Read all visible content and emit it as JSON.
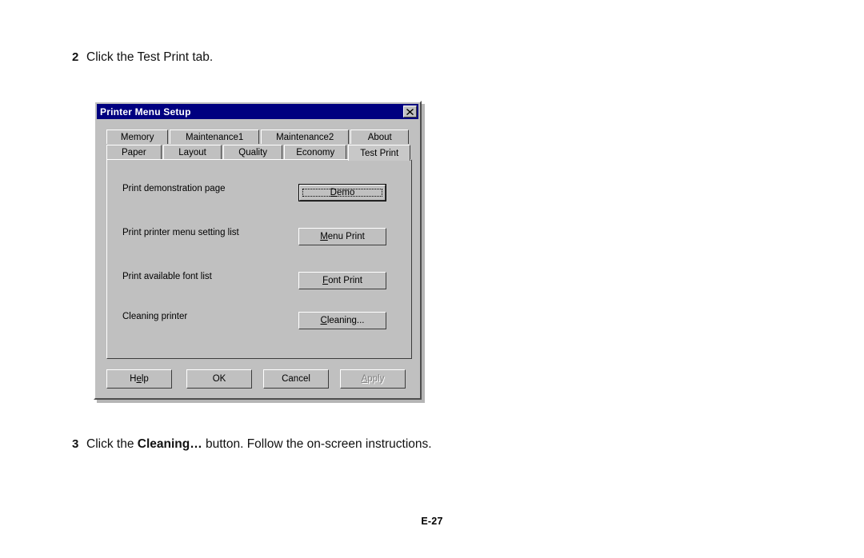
{
  "page": {
    "steps": [
      {
        "number": "2",
        "text": "Click the Test Print tab."
      },
      {
        "number": "3",
        "text_before": "Click the ",
        "emphasis": "Cleaning…",
        "text_after": " button.  Follow the on-screen instructions."
      }
    ],
    "footer": "E-27"
  },
  "dialog": {
    "title": "Printer Menu Setup",
    "close_button": "close-icon",
    "colors": {
      "titlebar": "#000080",
      "titlebar_text": "#ffffff",
      "face": "#c0c0c0",
      "shadow": "#3c3c3c",
      "highlight": "#ffffff",
      "disabled_text": "#808080"
    },
    "tabs": {
      "row_top": [
        {
          "label": "Memory",
          "selected": false
        },
        {
          "label": "Maintenance1",
          "selected": false
        },
        {
          "label": "Maintenance2",
          "selected": false
        },
        {
          "label": "About",
          "selected": false
        }
      ],
      "row_bottom": [
        {
          "label": "Paper",
          "selected": false
        },
        {
          "label": "Layout",
          "selected": false
        },
        {
          "label": "Quality",
          "selected": false
        },
        {
          "label": "Economy",
          "selected": false
        },
        {
          "label": "Test Print",
          "selected": true
        }
      ]
    },
    "panel": {
      "rows": [
        {
          "label": "Print demonstration page",
          "button": {
            "pre": "",
            "key": "D",
            "post": "emo",
            "state": "focused-default"
          }
        },
        {
          "label": "Print printer menu setting list",
          "button": {
            "pre": "",
            "key": "M",
            "post": "enu Print",
            "state": "normal"
          }
        },
        {
          "label": "Print available font list",
          "button": {
            "pre": "",
            "key": "F",
            "post": "ont Print",
            "state": "normal"
          }
        },
        {
          "label": "Cleaning printer",
          "button": {
            "pre": "",
            "key": "C",
            "post": "leaning...",
            "state": "normal"
          }
        }
      ]
    },
    "footer_buttons": [
      {
        "pre": "H",
        "key": "e",
        "post": "lp",
        "state": "normal"
      },
      {
        "pre": "OK",
        "key": "",
        "post": "",
        "state": "normal"
      },
      {
        "pre": "Cancel",
        "key": "",
        "post": "",
        "state": "normal"
      },
      {
        "pre": "",
        "key": "A",
        "post": "pply",
        "state": "disabled"
      }
    ]
  }
}
